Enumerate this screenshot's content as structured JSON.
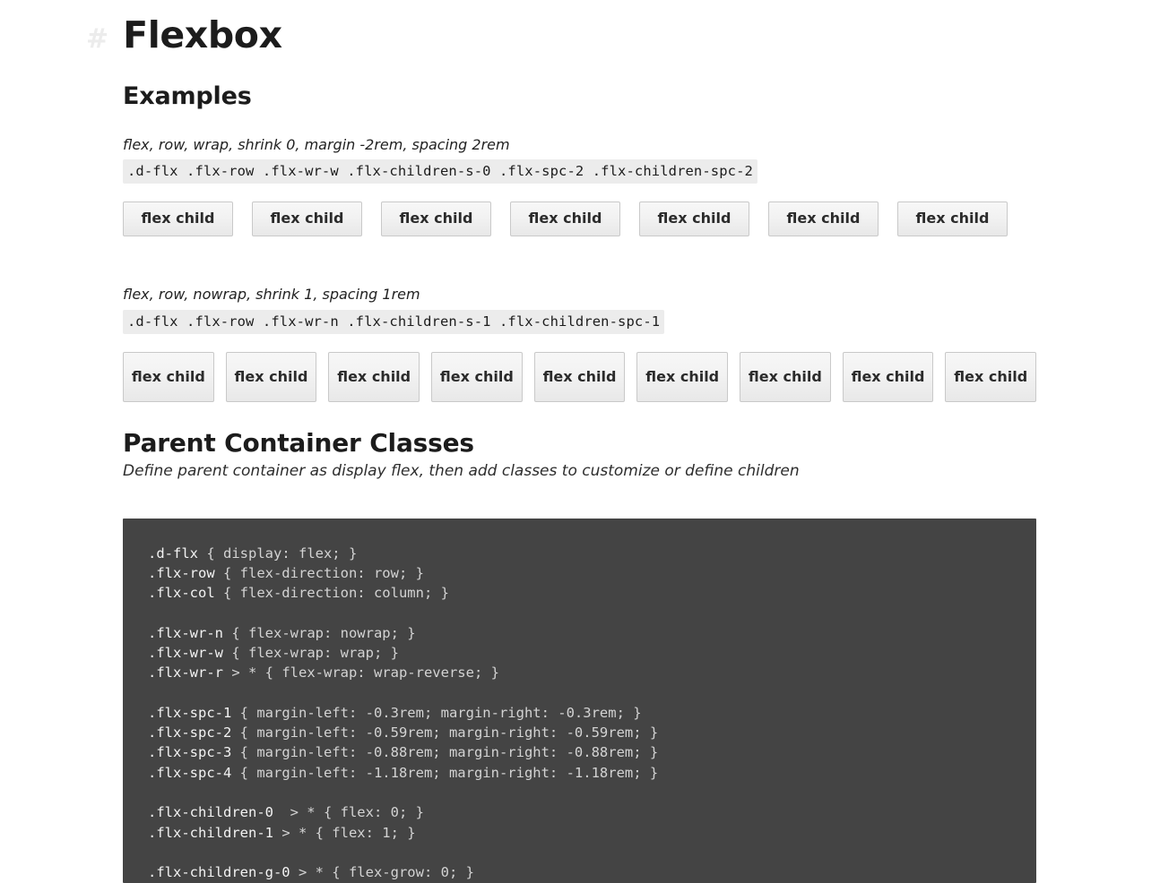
{
  "header": {
    "anchor": "#",
    "title": "Flexbox"
  },
  "examples": {
    "heading": "Examples",
    "items": [
      {
        "label": "flex, row, wrap, shrink 0, margin -2rem, spacing 2rem",
        "classes": ".d-flx .flx-row .flx-wr-w .flx-children-s-0 .flx-spc-2 .flx-children-spc-2",
        "child_label": "flex child",
        "child_count": 7
      },
      {
        "label": "flex, row, nowrap, shrink 1, spacing 1rem",
        "classes": ".d-flx .flx-row .flx-wr-n .flx-children-s-1 .flx-children-spc-1",
        "child_label": "flex child",
        "child_count": 9
      }
    ]
  },
  "parent_container": {
    "heading": "Parent Container Classes",
    "subtitle": "Define parent container as display flex, then add classes to customize or define children",
    "code_lines": [
      {
        "selector": ".d-flx",
        "body": " { display: flex; }"
      },
      {
        "selector": ".flx-row",
        "body": " { flex-direction: row; }"
      },
      {
        "selector": ".flx-col",
        "body": " { flex-direction: column; }"
      },
      {
        "selector": "",
        "body": ""
      },
      {
        "selector": ".flx-wr-n",
        "body": " { flex-wrap: nowrap; }"
      },
      {
        "selector": ".flx-wr-w",
        "body": " { flex-wrap: wrap; }"
      },
      {
        "selector": ".flx-wr-r",
        "body": " > * { flex-wrap: wrap-reverse; }"
      },
      {
        "selector": "",
        "body": ""
      },
      {
        "selector": ".flx-spc-1",
        "body": " { margin-left: -0.3rem; margin-right: -0.3rem; }"
      },
      {
        "selector": ".flx-spc-2",
        "body": " { margin-left: -0.59rem; margin-right: -0.59rem; }"
      },
      {
        "selector": ".flx-spc-3",
        "body": " { margin-left: -0.88rem; margin-right: -0.88rem; }"
      },
      {
        "selector": ".flx-spc-4",
        "body": " { margin-left: -1.18rem; margin-right: -1.18rem; }"
      },
      {
        "selector": "",
        "body": ""
      },
      {
        "selector": ".flx-children-0",
        "body": "  > * { flex: 0; }"
      },
      {
        "selector": ".flx-children-1",
        "body": " > * { flex: 1; }"
      },
      {
        "selector": "",
        "body": ""
      },
      {
        "selector": ".flx-children-g-0",
        "body": " > * { flex-grow: 0; }"
      }
    ]
  },
  "colors": {
    "code_background": "#444444",
    "code_text": "#e3e3e3",
    "inline_code_background": "#ececec",
    "anchor_hash": "#ececec",
    "heading_text": "#1c1c1c"
  }
}
